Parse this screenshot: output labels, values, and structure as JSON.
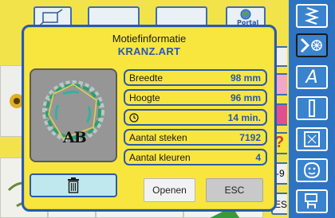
{
  "background": {
    "portal_label": "Portal",
    "partial_button_text": "-9",
    "partial_esc_text": "ESC"
  },
  "dialog": {
    "title": "Motiefinformatie",
    "filename": "KRANZ.ART",
    "preview_text": "AB",
    "rows": [
      {
        "label": "Breedte",
        "value": "98 mm"
      },
      {
        "label": "Hoogte",
        "value": "96 mm"
      },
      {
        "label": "",
        "icon": "clock-icon",
        "value": "14 min."
      },
      {
        "label": "Aantal steken",
        "value": "7192"
      },
      {
        "label": "Aantal kleuren",
        "value": "4"
      }
    ],
    "delete_icon": "trash-icon",
    "open_label": "Openen",
    "esc_label": "ESC"
  },
  "sidebar": {
    "items": [
      {
        "icon": "stitch-zigzag-icon"
      },
      {
        "icon": "embroidery-mode-icon"
      },
      {
        "icon": "lettering-a-icon",
        "glyph": "A"
      },
      {
        "icon": "buttonhole-icon"
      },
      {
        "icon": "frame-icon"
      },
      {
        "icon": "personal-program-smiley-icon"
      },
      {
        "icon": "setup-icon"
      }
    ]
  },
  "colors": {
    "accent": "#2a59b0",
    "panel": "#f8e63f",
    "sidebar": "#2d73c2"
  }
}
